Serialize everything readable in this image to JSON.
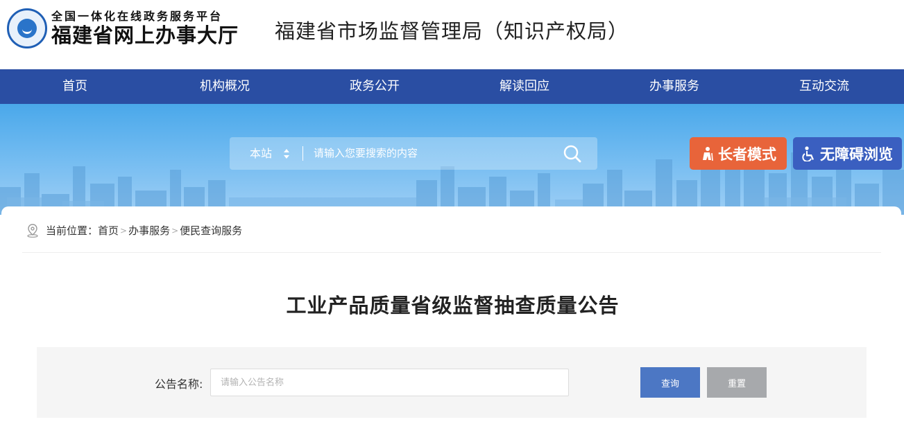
{
  "header": {
    "logo_line1": "全国一体化在线政务服务平台",
    "logo_line2": "福建省网上办事大厅",
    "site_title": "福建省市场监督管理局（知识产权局）"
  },
  "nav": {
    "items": [
      {
        "label": "首页"
      },
      {
        "label": "机构概况"
      },
      {
        "label": "政务公开"
      },
      {
        "label": "解读回应"
      },
      {
        "label": "办事服务"
      },
      {
        "label": "互动交流"
      }
    ]
  },
  "search": {
    "scope": "本站",
    "placeholder": "请输入您要搜索的内容"
  },
  "mode_buttons": {
    "elder_label": "长者模式",
    "access_label": "无障碍浏览"
  },
  "breadcrumb": {
    "prefix": "当前位置：",
    "items": [
      "首页",
      "办事服务",
      "便民查询服务"
    ],
    "separator": ">"
  },
  "page": {
    "heading": "工业产品质量省级监督抽查质量公告"
  },
  "filter": {
    "label": "公告名称:",
    "placeholder": "请输入公告名称",
    "value": "",
    "query_label": "查询",
    "reset_label": "重置"
  },
  "colors": {
    "nav_bg": "#2a4ea3",
    "elder_btn": "#e8643a",
    "access_btn": "#3a5fc0",
    "query_btn": "#4c77c4",
    "reset_btn": "#a7a9ac"
  }
}
